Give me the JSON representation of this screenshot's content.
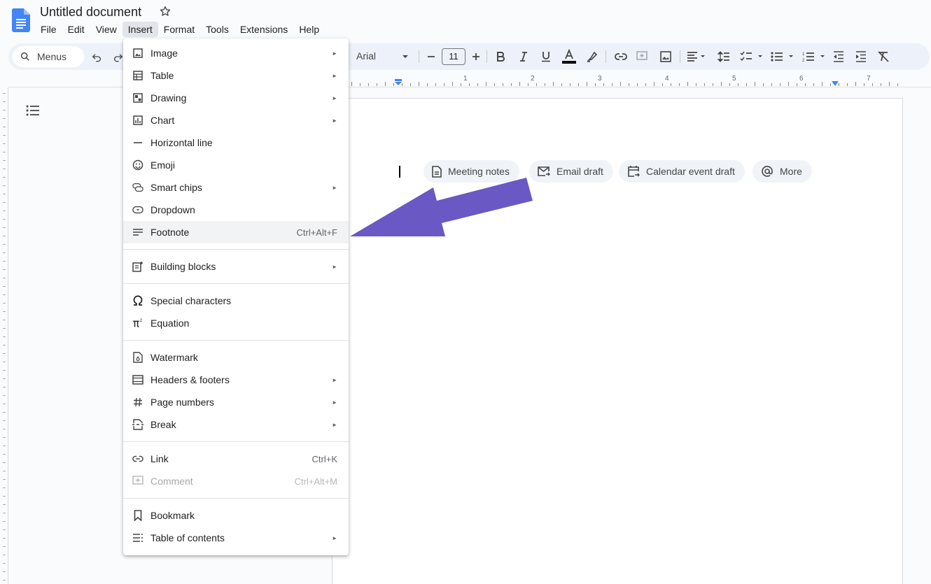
{
  "app": {
    "doc_title": "Untitled document"
  },
  "menubar": [
    {
      "label": "File"
    },
    {
      "label": "Edit"
    },
    {
      "label": "View"
    },
    {
      "label": "Insert",
      "active": true
    },
    {
      "label": "Format"
    },
    {
      "label": "Tools"
    },
    {
      "label": "Extensions"
    },
    {
      "label": "Help"
    }
  ],
  "toolbar": {
    "search_label": "Menus",
    "font_name": "Arial",
    "font_size": "11"
  },
  "ruler": {
    "numbers": [
      "1",
      "2",
      "3",
      "4",
      "5",
      "6",
      "7"
    ]
  },
  "chips": [
    {
      "label": "Meeting notes",
      "icon": "document-icon"
    },
    {
      "label": "Email draft",
      "icon": "email-icon"
    },
    {
      "label": "Calendar event draft",
      "icon": "calendar-icon"
    },
    {
      "label": "More",
      "icon": "at-sign-icon"
    }
  ],
  "insert_menu": {
    "groups": [
      [
        {
          "label": "Image",
          "icon": "image-icon",
          "submenu": true
        },
        {
          "label": "Table",
          "icon": "table-icon",
          "submenu": true
        },
        {
          "label": "Drawing",
          "icon": "drawing-icon",
          "submenu": true
        },
        {
          "label": "Chart",
          "icon": "chart-icon",
          "submenu": true
        },
        {
          "label": "Horizontal line",
          "icon": "horizontal-line-icon"
        },
        {
          "label": "Emoji",
          "icon": "emoji-icon"
        },
        {
          "label": "Smart chips",
          "icon": "smart-chips-icon",
          "submenu": true
        },
        {
          "label": "Dropdown",
          "icon": "dropdown-icon"
        },
        {
          "label": "Footnote",
          "icon": "footnote-icon",
          "shortcut": "Ctrl+Alt+F",
          "highlighted": true
        }
      ],
      [
        {
          "label": "Building blocks",
          "icon": "building-blocks-icon",
          "submenu": true
        }
      ],
      [
        {
          "label": "Special characters",
          "icon": "omega-icon"
        },
        {
          "label": "Equation",
          "icon": "pi-icon"
        }
      ],
      [
        {
          "label": "Watermark",
          "icon": "watermark-icon"
        },
        {
          "label": "Headers & footers",
          "icon": "headers-footers-icon",
          "submenu": true
        },
        {
          "label": "Page numbers",
          "icon": "hash-icon",
          "submenu": true
        },
        {
          "label": "Break",
          "icon": "break-icon",
          "submenu": true
        }
      ],
      [
        {
          "label": "Link",
          "icon": "link-icon",
          "shortcut": "Ctrl+K"
        },
        {
          "label": "Comment",
          "icon": "comment-icon",
          "shortcut": "Ctrl+Alt+M",
          "disabled": true
        }
      ],
      [
        {
          "label": "Bookmark",
          "icon": "bookmark-icon"
        },
        {
          "label": "Table of contents",
          "icon": "table-of-contents-icon",
          "submenu": true
        }
      ]
    ],
    "submenu_glyph": "►"
  },
  "colors": {
    "accent_blue": "#4285f4",
    "arrow_purple": "#6a58c4",
    "toolbar_bg": "#edf2fa",
    "page_bg": "#f9fbfd"
  }
}
